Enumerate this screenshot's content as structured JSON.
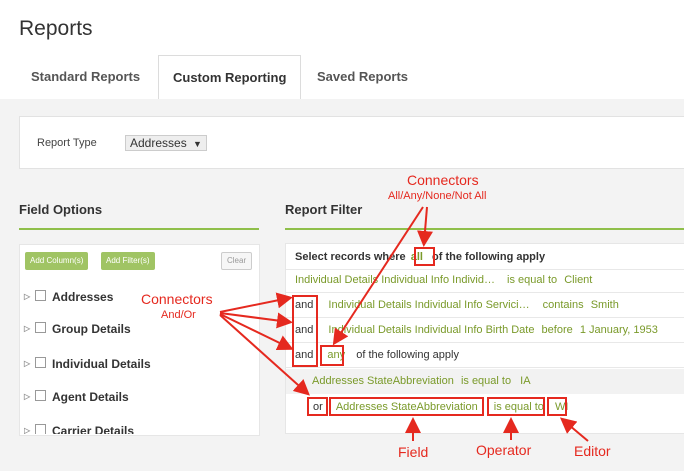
{
  "page": {
    "title": "Reports"
  },
  "tabs": [
    {
      "label": "Standard Reports"
    },
    {
      "label": "Custom Reporting",
      "active": true
    },
    {
      "label": "Saved Reports"
    }
  ],
  "report_type": {
    "label": "Report Type",
    "value": "Addresses"
  },
  "field_options": {
    "heading": "Field Options",
    "buttons": {
      "add_columns": "Add Column(s)",
      "add_filters": "Add Filter(s)",
      "clear": "Clear"
    },
    "tree": [
      "Addresses",
      "Group Details",
      "Individual Details",
      "Agent Details",
      "Carrier Details"
    ]
  },
  "report_filter": {
    "heading": "Report Filter",
    "header": {
      "prefix": "Select records where",
      "quantifier": "all",
      "suffix": "of the following apply"
    },
    "rows": [
      {
        "connector": "",
        "field": "Individual Details Individual Info Individ…",
        "operator": "is equal to",
        "value": "Client"
      },
      {
        "connector": "and",
        "field": "Individual Details Individual Info Servici…",
        "operator": "contains",
        "value": "Smith"
      },
      {
        "connector": "and",
        "field": "Individual Details Individual Info Birth Date",
        "operator": "before",
        "value": "1 January, 1953"
      }
    ],
    "group": {
      "connector": "and",
      "quantifier": "any",
      "suffix": "of the following apply",
      "rows": [
        {
          "connector": "",
          "field": "Addresses StateAbbreviation",
          "operator": "is equal to",
          "value": "IA"
        },
        {
          "connector": "or",
          "field": "Addresses StateAbbreviation",
          "operator": "is equal to",
          "value": "WI"
        }
      ]
    }
  },
  "annotations": {
    "connectors_top": {
      "title": "Connectors",
      "sub": "All/Any/None/Not All"
    },
    "connectors_left": {
      "title": "Connectors",
      "sub": "And/Or"
    },
    "field": "Field",
    "operator": "Operator",
    "editor": "Editor"
  },
  "colors": {
    "accent_green": "#8fbf4a",
    "annotation_red": "#e5291f",
    "link_green": "#7a9a2a"
  }
}
